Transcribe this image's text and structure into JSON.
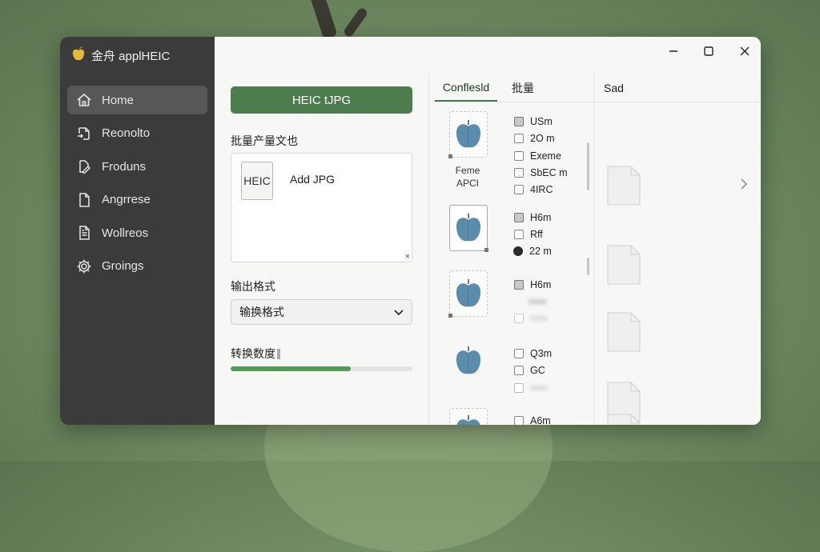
{
  "app": {
    "title": "金舟 applHEIC",
    "logo_icon": "apple-logo-icon"
  },
  "sidebar": {
    "items": [
      {
        "label": "Home",
        "icon": "home-icon",
        "active": true
      },
      {
        "label": "Reonolto",
        "icon": "convert-icon"
      },
      {
        "label": "Froduns",
        "icon": "edit-icon"
      },
      {
        "label": "Angrrese",
        "icon": "document-icon"
      },
      {
        "label": "Wollreos",
        "icon": "list-document-icon"
      },
      {
        "label": "Groings",
        "icon": "gear-icon"
      }
    ]
  },
  "window_controls": {
    "minimize": "minimize-icon",
    "maximize": "maximize-icon",
    "close": "close-icon"
  },
  "left_panel": {
    "convert_button": "HEIC tJPG",
    "batch_label": "批量产量文也",
    "heic_chip": "HEIC",
    "add_label": "Add JPG",
    "close_glyph": "×",
    "output_format_label": "输出格式",
    "output_format_value": "输换格式",
    "progress_label": "转换数度",
    "progress_fraction": 0.66
  },
  "file_panel": {
    "tabs": [
      "Conflesld",
      "批量",
      "Sad"
    ],
    "active_tab": 0,
    "rows": [
      {
        "caption": [
          "Feme",
          "APCI"
        ],
        "options": [
          {
            "label": "USm",
            "type": "checkbox",
            "checked": true
          },
          {
            "label": "2O m",
            "type": "checkbox",
            "checked": false
          },
          {
            "label": "Exeme",
            "type": "checkbox",
            "checked": false
          },
          {
            "label": "SbEC m",
            "type": "checkbox",
            "checked": false
          },
          {
            "label": "4IRC",
            "type": "checkbox",
            "checked": false
          }
        ]
      },
      {
        "caption": [],
        "options": [
          {
            "label": "H6m",
            "type": "checkbox",
            "checked": true
          },
          {
            "label": "Rff",
            "type": "checkbox",
            "checked": false
          },
          {
            "label": "22 m",
            "type": "radio",
            "checked": true
          }
        ]
      },
      {
        "caption": [],
        "options": [
          {
            "label": "H6m",
            "type": "checkbox",
            "checked": true
          },
          {
            "label": "",
            "type": "blurred",
            "checked": false
          },
          {
            "label": "",
            "type": "checkbox-blurred",
            "checked": false
          }
        ]
      },
      {
        "caption": [],
        "options": [
          {
            "label": "Q3m",
            "type": "checkbox",
            "checked": false
          },
          {
            "label": "GC",
            "type": "checkbox",
            "checked": false
          },
          {
            "label": "",
            "type": "checkbox-blurred",
            "checked": false
          }
        ]
      },
      {
        "caption": [],
        "options": [
          {
            "label": "A6m",
            "type": "checkbox",
            "checked": false
          }
        ]
      }
    ],
    "chevron_icon": "chevron-right-icon",
    "file_icon": "file-icon"
  },
  "colors": {
    "accent": "#4d7d4e",
    "progress": "#4f9a57",
    "sidebar": "#3a3b3a",
    "apple": "#5b8cab"
  }
}
